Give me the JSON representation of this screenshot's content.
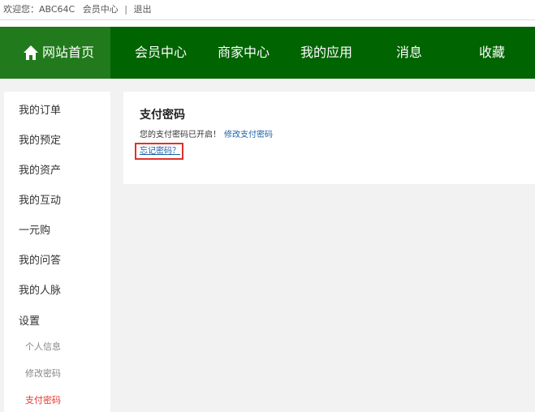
{
  "topbar": {
    "welcome": "欢迎您：ABC64C",
    "member_center": "会员中心",
    "separator": "|",
    "logout": "退出"
  },
  "nav": {
    "home": "网站首页",
    "items": [
      "会员中心",
      "商家中心",
      "我的应用",
      "消息",
      "收藏"
    ],
    "active": "会员中心",
    "colors": {
      "bar": "#006400",
      "home": "#217a1c"
    }
  },
  "sidebar": {
    "items": [
      "我的订单",
      "我的预定",
      "我的资产",
      "我的互动",
      "一元购",
      "我的问答",
      "我的人脉",
      "设置"
    ],
    "sub_items": [
      "个人信息",
      "修改密码",
      "支付密码"
    ],
    "active_sub": "支付密码",
    "active_color": "#e2392e"
  },
  "main": {
    "title": "支付密码",
    "status_text": "您的支付密码已开启！",
    "modify_link": "修改支付密码",
    "forgot_link": "忘记密码？",
    "highlight_color": "#e0312c"
  }
}
